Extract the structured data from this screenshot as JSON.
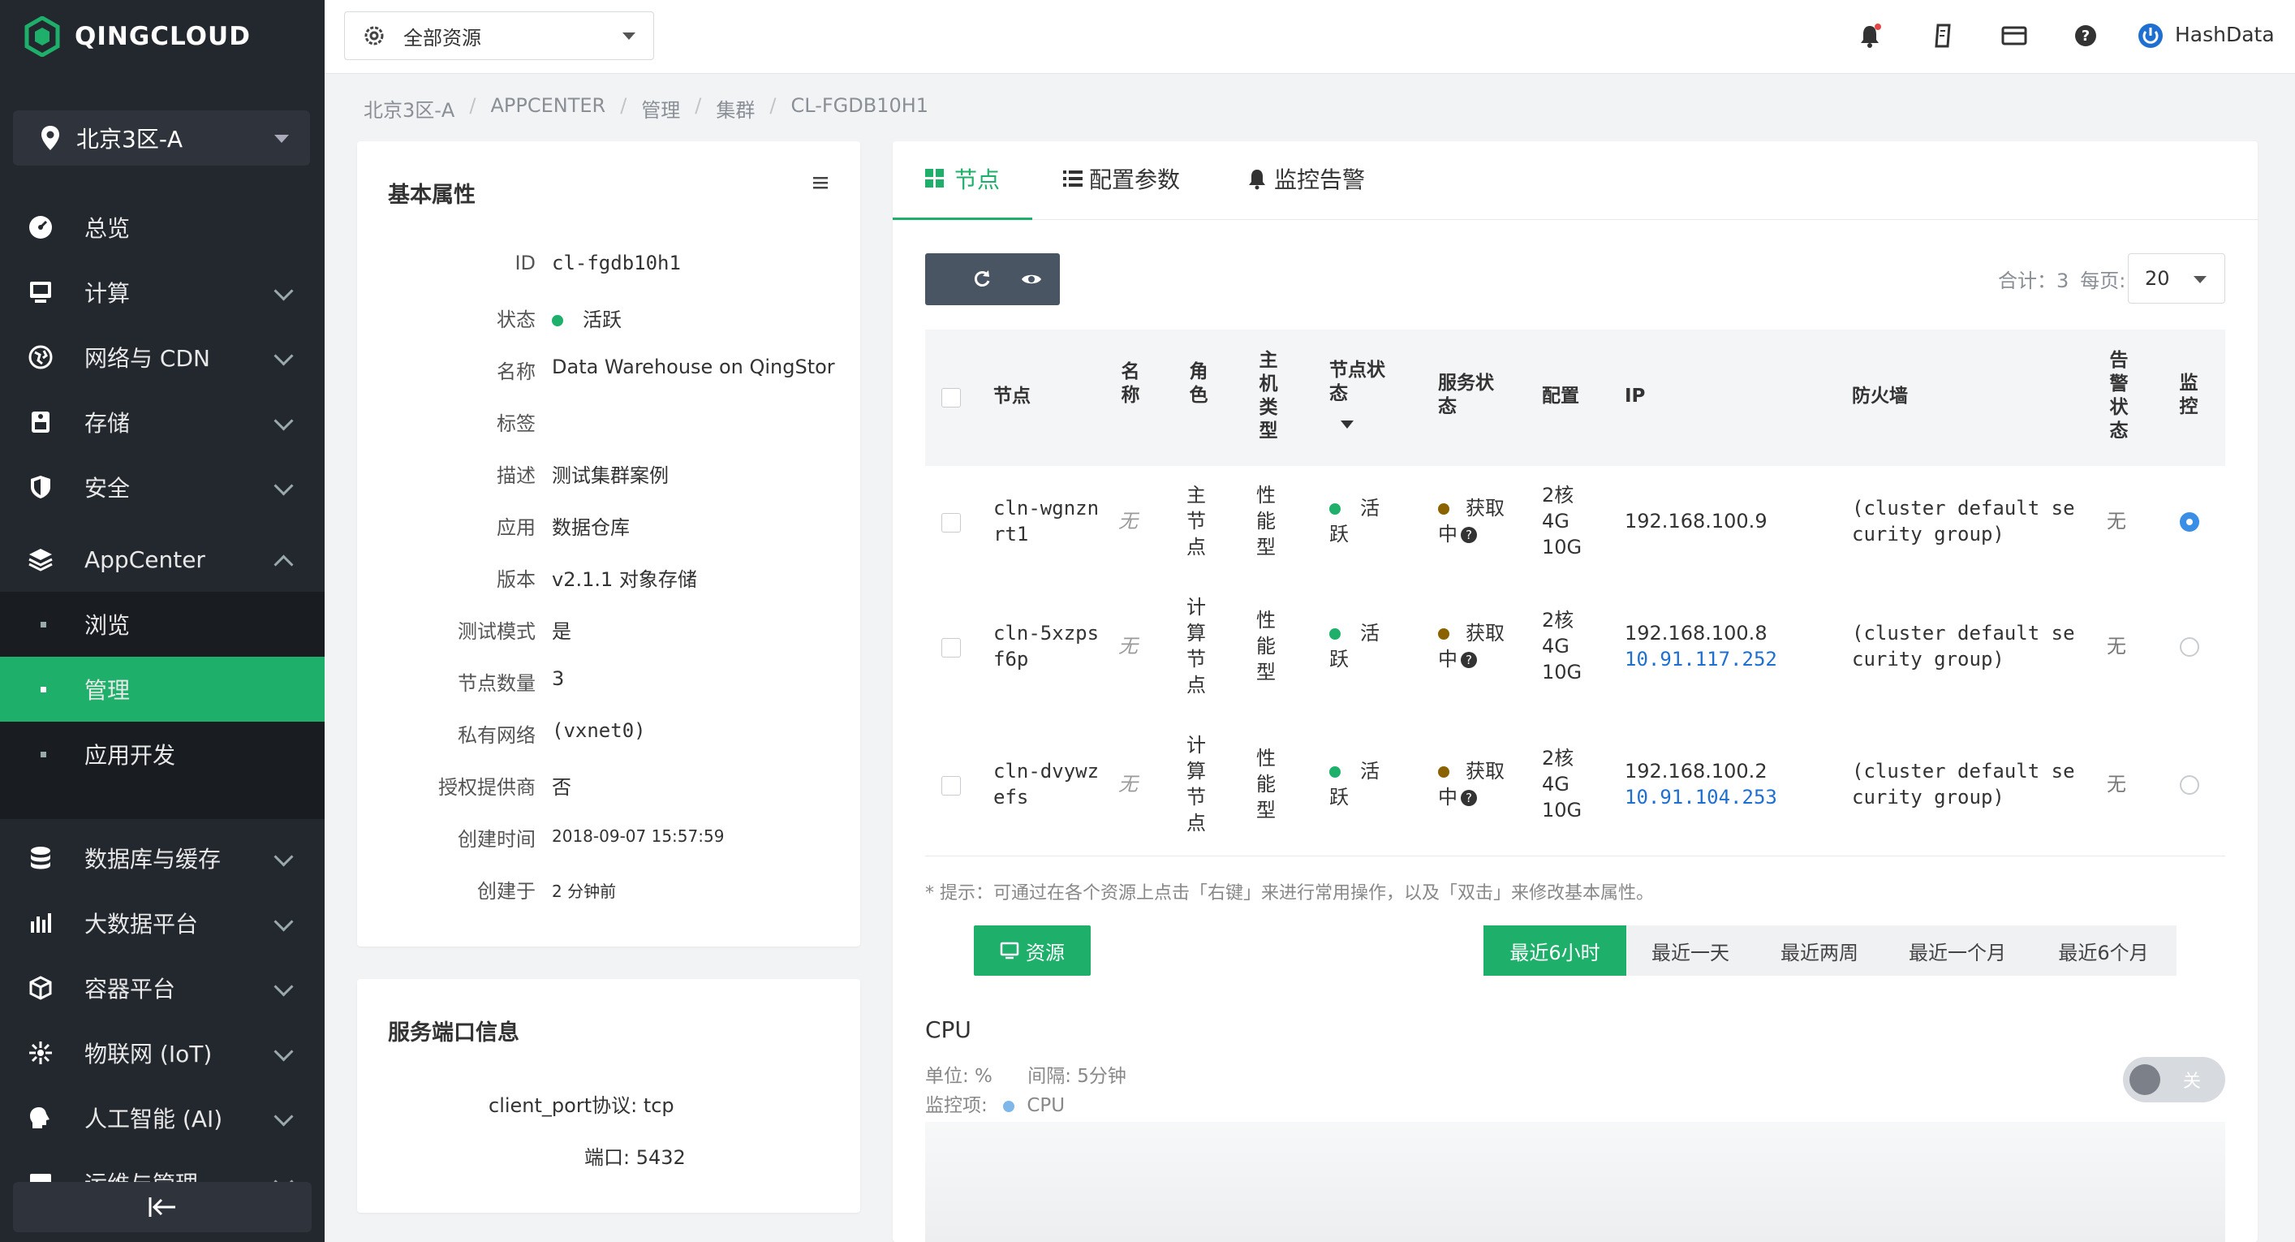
{
  "brand": {
    "name": "QINGCLOUD",
    "accent": "#1eb06a"
  },
  "sidebar": {
    "zone": "北京3区-A",
    "items": [
      {
        "label": "总览",
        "icon": "dashboard-icon"
      },
      {
        "label": "计算",
        "icon": "monitor-icon"
      },
      {
        "label": "网络与 CDN",
        "icon": "globe-icon"
      },
      {
        "label": "存储",
        "icon": "storage-icon"
      },
      {
        "label": "安全",
        "icon": "shield-icon"
      },
      {
        "label": "AppCenter",
        "icon": "layers-icon"
      },
      {
        "label": "数据库与缓存",
        "icon": "database-icon"
      },
      {
        "label": "大数据平台",
        "icon": "bar-chart-icon"
      },
      {
        "label": "容器平台",
        "icon": "cube-icon"
      },
      {
        "label": "物联网 (IoT)",
        "icon": "iot-icon"
      },
      {
        "label": "人工智能 (AI)",
        "icon": "brain-icon"
      },
      {
        "label": "运维与管理",
        "icon": "ops-icon"
      }
    ],
    "appcenter_sub": [
      "浏览",
      "管理",
      "应用开发"
    ]
  },
  "topbar": {
    "resource_select": "全部资源",
    "user": "HashData"
  },
  "breadcrumb": [
    "北京3区-A",
    "APPCENTER",
    "管理",
    "集群",
    "CL-FGDB10H1"
  ],
  "basic": {
    "title": "基本属性",
    "rows": [
      {
        "k": "ID",
        "v": "cl-fgdb10h1"
      },
      {
        "k": "状态",
        "v": "活跃"
      },
      {
        "k": "名称",
        "v": "Data Warehouse on QingStor"
      },
      {
        "k": "标签",
        "v": ""
      },
      {
        "k": "描述",
        "v": "测试集群案例"
      },
      {
        "k": "应用",
        "v": "数据仓库"
      },
      {
        "k": "版本",
        "v": "v2.1.1 对象存储"
      },
      {
        "k": "测试模式",
        "v": "是"
      },
      {
        "k": "节点数量",
        "v": "3"
      },
      {
        "k": "私有网络",
        "v": "(vxnet0)"
      },
      {
        "k": "授权提供商",
        "v": "否"
      },
      {
        "k": "创建时间",
        "v": "2018-09-07 15:57:59"
      },
      {
        "k": "创建于",
        "v": "2 分钟前"
      }
    ]
  },
  "ports": {
    "title": "服务端口信息",
    "protocol": "client_port协议: tcp",
    "port": "端口: 5432"
  },
  "tabs": [
    "节点",
    "配置参数",
    "监控告警"
  ],
  "summary": {
    "total": "合计：3",
    "per_page_label": "每页:",
    "per_page": "20"
  },
  "table": {
    "headers": {
      "node": "节点",
      "name": "名称",
      "role": "角色",
      "host_type": "主机类型",
      "node_status": "节点状态",
      "service_status": "服务状态",
      "config": "配置",
      "ip": "IP",
      "firewall": "防火墙",
      "alert": "告警状态",
      "monitor": "监控"
    },
    "rows": [
      {
        "node": "cln-wgnznrt1",
        "name": "无",
        "role": "主节点",
        "host": "性能型",
        "status": "活跃",
        "service": "获取中",
        "cfg1": "2核",
        "cfg2": "4G",
        "cfg3": "10G",
        "ip1": "192.168.100.9",
        "ip2": "",
        "fw": "(cluster default security group)",
        "alert": "无"
      },
      {
        "node": "cln-5xzpsf6p",
        "name": "无",
        "role": "计算节点",
        "host": "性能型",
        "status": "活跃",
        "service": "获取中",
        "cfg1": "2核",
        "cfg2": "4G",
        "cfg3": "10G",
        "ip1": "192.168.100.8",
        "ip2": "10.91.117.252",
        "fw": "(cluster default security group)",
        "alert": "无"
      },
      {
        "node": "cln-dvywzefs",
        "name": "无",
        "role": "计算节点",
        "host": "性能型",
        "status": "活跃",
        "service": "获取中",
        "cfg1": "2核",
        "cfg2": "4G",
        "cfg3": "10G",
        "ip1": "192.168.100.2",
        "ip2": "10.91.104.253",
        "fw": "(cluster default security group)",
        "alert": "无"
      }
    ]
  },
  "hint": "* 提示：可通过在各个资源上点击「右键」来进行常用操作，以及「双击」来修改基本属性。",
  "resource_btn": "资源",
  "ranges": [
    "最近6小时",
    "最近一天",
    "最近两周",
    "最近一个月",
    "最近6个月"
  ],
  "cpu": {
    "title": "CPU",
    "unit": "单位: %",
    "interval": "间隔: 5分钟",
    "item_label": "监控项:",
    "item": "CPU",
    "toggle": "关"
  }
}
